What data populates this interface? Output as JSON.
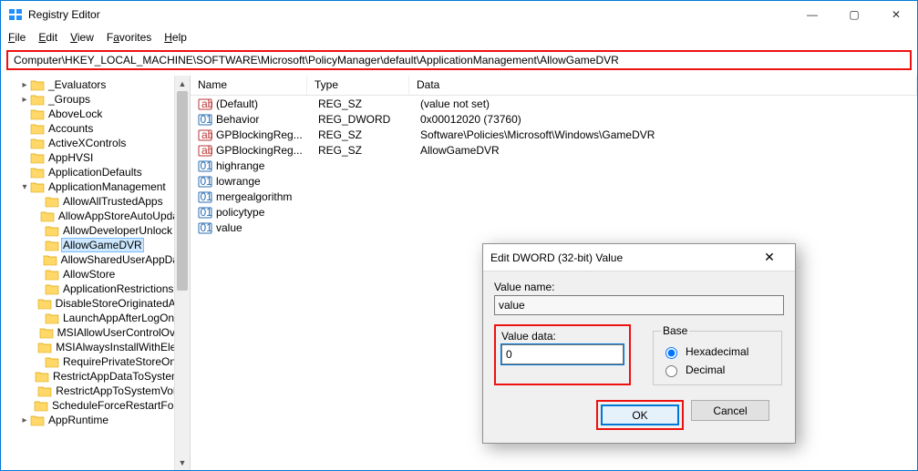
{
  "window": {
    "title": "Registry Editor",
    "minimize": "—",
    "maximize": "▢",
    "close": "✕"
  },
  "menu": {
    "file": "File",
    "edit": "Edit",
    "view": "View",
    "favorites": "Favorites",
    "help": "Help"
  },
  "address": "Computer\\HKEY_LOCAL_MACHINE\\SOFTWARE\\Microsoft\\PolicyManager\\default\\ApplicationManagement\\AllowGameDVR",
  "tree": [
    {
      "d": 1,
      "c": "▸",
      "n": "_Evaluators"
    },
    {
      "d": 1,
      "c": "▸",
      "n": "_Groups"
    },
    {
      "d": 1,
      "c": "",
      "n": "AboveLock"
    },
    {
      "d": 1,
      "c": "",
      "n": "Accounts"
    },
    {
      "d": 1,
      "c": "",
      "n": "ActiveXControls"
    },
    {
      "d": 1,
      "c": "",
      "n": "AppHVSI"
    },
    {
      "d": 1,
      "c": "",
      "n": "ApplicationDefaults"
    },
    {
      "d": 1,
      "c": "▾",
      "n": "ApplicationManagement"
    },
    {
      "d": 2,
      "c": "",
      "n": "AllowAllTrustedApps"
    },
    {
      "d": 2,
      "c": "",
      "n": "AllowAppStoreAutoUpdate"
    },
    {
      "d": 2,
      "c": "",
      "n": "AllowDeveloperUnlock"
    },
    {
      "d": 2,
      "c": "",
      "n": "AllowGameDVR",
      "sel": true
    },
    {
      "d": 2,
      "c": "",
      "n": "AllowSharedUserAppData"
    },
    {
      "d": 2,
      "c": "",
      "n": "AllowStore"
    },
    {
      "d": 2,
      "c": "",
      "n": "ApplicationRestrictions"
    },
    {
      "d": 2,
      "c": "",
      "n": "DisableStoreOriginatedApp"
    },
    {
      "d": 2,
      "c": "",
      "n": "LaunchAppAfterLogOn"
    },
    {
      "d": 2,
      "c": "",
      "n": "MSIAllowUserControlOverI"
    },
    {
      "d": 2,
      "c": "",
      "n": "MSIAlwaysInstallWithEleva"
    },
    {
      "d": 2,
      "c": "",
      "n": "RequirePrivateStoreOnly"
    },
    {
      "d": 2,
      "c": "",
      "n": "RestrictAppDataToSystemV"
    },
    {
      "d": 2,
      "c": "",
      "n": "RestrictAppToSystemVolun"
    },
    {
      "d": 2,
      "c": "",
      "n": "ScheduleForceRestartForUp"
    },
    {
      "d": 1,
      "c": "▸",
      "n": "AppRuntime"
    }
  ],
  "columns": {
    "name": "Name",
    "type": "Type",
    "data": "Data"
  },
  "values": [
    {
      "icon": "str",
      "name": "(Default)",
      "type": "REG_SZ",
      "data": "(value not set)"
    },
    {
      "icon": "bin",
      "name": "Behavior",
      "type": "REG_DWORD",
      "data": "0x00012020 (73760)"
    },
    {
      "icon": "str",
      "name": "GPBlockingReg...",
      "type": "REG_SZ",
      "data": "Software\\Policies\\Microsoft\\Windows\\GameDVR"
    },
    {
      "icon": "str",
      "name": "GPBlockingReg...",
      "type": "REG_SZ",
      "data": "AllowGameDVR"
    },
    {
      "icon": "bin",
      "name": "highrange",
      "type": "",
      "data": ""
    },
    {
      "icon": "bin",
      "name": "lowrange",
      "type": "",
      "data": ""
    },
    {
      "icon": "bin",
      "name": "mergealgorithm",
      "type": "",
      "data": ""
    },
    {
      "icon": "bin",
      "name": "policytype",
      "type": "",
      "data": ""
    },
    {
      "icon": "bin",
      "name": "value",
      "type": "",
      "data": ""
    }
  ],
  "dialog": {
    "title": "Edit DWORD (32-bit) Value",
    "valuename_label": "Value name:",
    "valuename": "value",
    "valuedata_label": "Value data:",
    "valuedata": "0",
    "base_label": "Base",
    "hex": "Hexadecimal",
    "dec": "Decimal",
    "ok": "OK",
    "cancel": "Cancel",
    "close": "✕"
  }
}
